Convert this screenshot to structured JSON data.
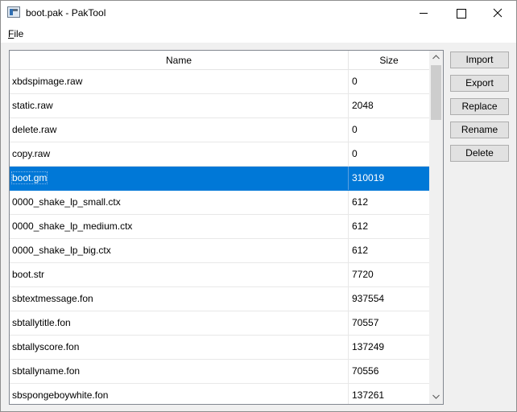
{
  "window": {
    "title": "boot.pak - PakTool",
    "icon": "app-icon"
  },
  "menu": {
    "file_label_underlined": "F",
    "file_label_rest": "ile"
  },
  "table": {
    "columns": [
      "Name",
      "Size"
    ],
    "rows": [
      {
        "name": "xbdspimage.raw",
        "size": "0"
      },
      {
        "name": "static.raw",
        "size": "2048"
      },
      {
        "name": "delete.raw",
        "size": "0"
      },
      {
        "name": "copy.raw",
        "size": "0"
      },
      {
        "name": "boot.gm",
        "size": "310019",
        "selected": true
      },
      {
        "name": "0000_shake_lp_small.ctx",
        "size": "612"
      },
      {
        "name": "0000_shake_lp_medium.ctx",
        "size": "612"
      },
      {
        "name": "0000_shake_lp_big.ctx",
        "size": "612"
      },
      {
        "name": "boot.str",
        "size": "7720"
      },
      {
        "name": "sbtextmessage.fon",
        "size": "937554"
      },
      {
        "name": "sbtallytitle.fon",
        "size": "70557"
      },
      {
        "name": "sbtallyscore.fon",
        "size": "137249"
      },
      {
        "name": "sbtallyname.fon",
        "size": "70556"
      },
      {
        "name": "sbspongeboywhite.fon",
        "size": "137261"
      }
    ]
  },
  "actions": {
    "import": "Import",
    "export": "Export",
    "replace": "Replace",
    "rename": "Rename",
    "delete": "Delete"
  },
  "colors": {
    "selection": "#0078d7"
  }
}
